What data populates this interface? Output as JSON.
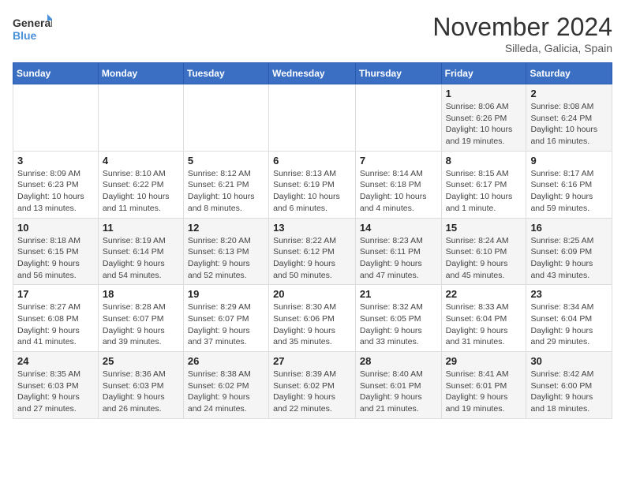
{
  "logo": {
    "line1": "General",
    "line2": "Blue"
  },
  "title": "November 2024",
  "location": "Silleda, Galicia, Spain",
  "weekdays": [
    "Sunday",
    "Monday",
    "Tuesday",
    "Wednesday",
    "Thursday",
    "Friday",
    "Saturday"
  ],
  "weeks": [
    [
      {
        "day": "",
        "info": ""
      },
      {
        "day": "",
        "info": ""
      },
      {
        "day": "",
        "info": ""
      },
      {
        "day": "",
        "info": ""
      },
      {
        "day": "",
        "info": ""
      },
      {
        "day": "1",
        "info": "Sunrise: 8:06 AM\nSunset: 6:26 PM\nDaylight: 10 hours and 19 minutes."
      },
      {
        "day": "2",
        "info": "Sunrise: 8:08 AM\nSunset: 6:24 PM\nDaylight: 10 hours and 16 minutes."
      }
    ],
    [
      {
        "day": "3",
        "info": "Sunrise: 8:09 AM\nSunset: 6:23 PM\nDaylight: 10 hours and 13 minutes."
      },
      {
        "day": "4",
        "info": "Sunrise: 8:10 AM\nSunset: 6:22 PM\nDaylight: 10 hours and 11 minutes."
      },
      {
        "day": "5",
        "info": "Sunrise: 8:12 AM\nSunset: 6:21 PM\nDaylight: 10 hours and 8 minutes."
      },
      {
        "day": "6",
        "info": "Sunrise: 8:13 AM\nSunset: 6:19 PM\nDaylight: 10 hours and 6 minutes."
      },
      {
        "day": "7",
        "info": "Sunrise: 8:14 AM\nSunset: 6:18 PM\nDaylight: 10 hours and 4 minutes."
      },
      {
        "day": "8",
        "info": "Sunrise: 8:15 AM\nSunset: 6:17 PM\nDaylight: 10 hours and 1 minute."
      },
      {
        "day": "9",
        "info": "Sunrise: 8:17 AM\nSunset: 6:16 PM\nDaylight: 9 hours and 59 minutes."
      }
    ],
    [
      {
        "day": "10",
        "info": "Sunrise: 8:18 AM\nSunset: 6:15 PM\nDaylight: 9 hours and 56 minutes."
      },
      {
        "day": "11",
        "info": "Sunrise: 8:19 AM\nSunset: 6:14 PM\nDaylight: 9 hours and 54 minutes."
      },
      {
        "day": "12",
        "info": "Sunrise: 8:20 AM\nSunset: 6:13 PM\nDaylight: 9 hours and 52 minutes."
      },
      {
        "day": "13",
        "info": "Sunrise: 8:22 AM\nSunset: 6:12 PM\nDaylight: 9 hours and 50 minutes."
      },
      {
        "day": "14",
        "info": "Sunrise: 8:23 AM\nSunset: 6:11 PM\nDaylight: 9 hours and 47 minutes."
      },
      {
        "day": "15",
        "info": "Sunrise: 8:24 AM\nSunset: 6:10 PM\nDaylight: 9 hours and 45 minutes."
      },
      {
        "day": "16",
        "info": "Sunrise: 8:25 AM\nSunset: 6:09 PM\nDaylight: 9 hours and 43 minutes."
      }
    ],
    [
      {
        "day": "17",
        "info": "Sunrise: 8:27 AM\nSunset: 6:08 PM\nDaylight: 9 hours and 41 minutes."
      },
      {
        "day": "18",
        "info": "Sunrise: 8:28 AM\nSunset: 6:07 PM\nDaylight: 9 hours and 39 minutes."
      },
      {
        "day": "19",
        "info": "Sunrise: 8:29 AM\nSunset: 6:07 PM\nDaylight: 9 hours and 37 minutes."
      },
      {
        "day": "20",
        "info": "Sunrise: 8:30 AM\nSunset: 6:06 PM\nDaylight: 9 hours and 35 minutes."
      },
      {
        "day": "21",
        "info": "Sunrise: 8:32 AM\nSunset: 6:05 PM\nDaylight: 9 hours and 33 minutes."
      },
      {
        "day": "22",
        "info": "Sunrise: 8:33 AM\nSunset: 6:04 PM\nDaylight: 9 hours and 31 minutes."
      },
      {
        "day": "23",
        "info": "Sunrise: 8:34 AM\nSunset: 6:04 PM\nDaylight: 9 hours and 29 minutes."
      }
    ],
    [
      {
        "day": "24",
        "info": "Sunrise: 8:35 AM\nSunset: 6:03 PM\nDaylight: 9 hours and 27 minutes."
      },
      {
        "day": "25",
        "info": "Sunrise: 8:36 AM\nSunset: 6:03 PM\nDaylight: 9 hours and 26 minutes."
      },
      {
        "day": "26",
        "info": "Sunrise: 8:38 AM\nSunset: 6:02 PM\nDaylight: 9 hours and 24 minutes."
      },
      {
        "day": "27",
        "info": "Sunrise: 8:39 AM\nSunset: 6:02 PM\nDaylight: 9 hours and 22 minutes."
      },
      {
        "day": "28",
        "info": "Sunrise: 8:40 AM\nSunset: 6:01 PM\nDaylight: 9 hours and 21 minutes."
      },
      {
        "day": "29",
        "info": "Sunrise: 8:41 AM\nSunset: 6:01 PM\nDaylight: 9 hours and 19 minutes."
      },
      {
        "day": "30",
        "info": "Sunrise: 8:42 AM\nSunset: 6:00 PM\nDaylight: 9 hours and 18 minutes."
      }
    ]
  ]
}
